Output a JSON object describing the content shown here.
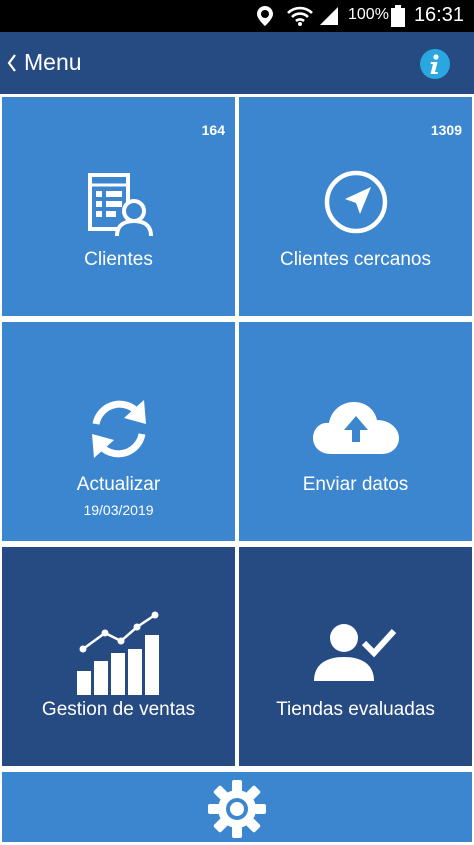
{
  "status_bar": {
    "battery": "100%",
    "time": "16:31",
    "icons": [
      "location-icon",
      "wifi-icon",
      "signal-icon",
      "battery-icon"
    ]
  },
  "header": {
    "title": "Menu",
    "back_icon": "chevron-left-icon",
    "info_icon": "info-icon"
  },
  "tiles": [
    {
      "label": "Clientes",
      "count": "164",
      "icon": "clients-list-icon"
    },
    {
      "label": "Clientes cercanos",
      "count": "1309",
      "icon": "navigation-icon"
    },
    {
      "label": "Actualizar",
      "sublabel": "19/03/2019",
      "icon": "refresh-icon"
    },
    {
      "label": "Enviar datos",
      "icon": "cloud-upload-icon"
    },
    {
      "label": "Gestion de ventas",
      "icon": "sales-chart-icon"
    },
    {
      "label": "Tiendas evaluadas",
      "icon": "user-check-icon"
    }
  ],
  "footer": {
    "icon": "gear-icon"
  },
  "colors": {
    "light_tile": "#3c86cf",
    "dark_tile": "#264a82",
    "header": "#264a82",
    "info": "#2aa7e0"
  }
}
